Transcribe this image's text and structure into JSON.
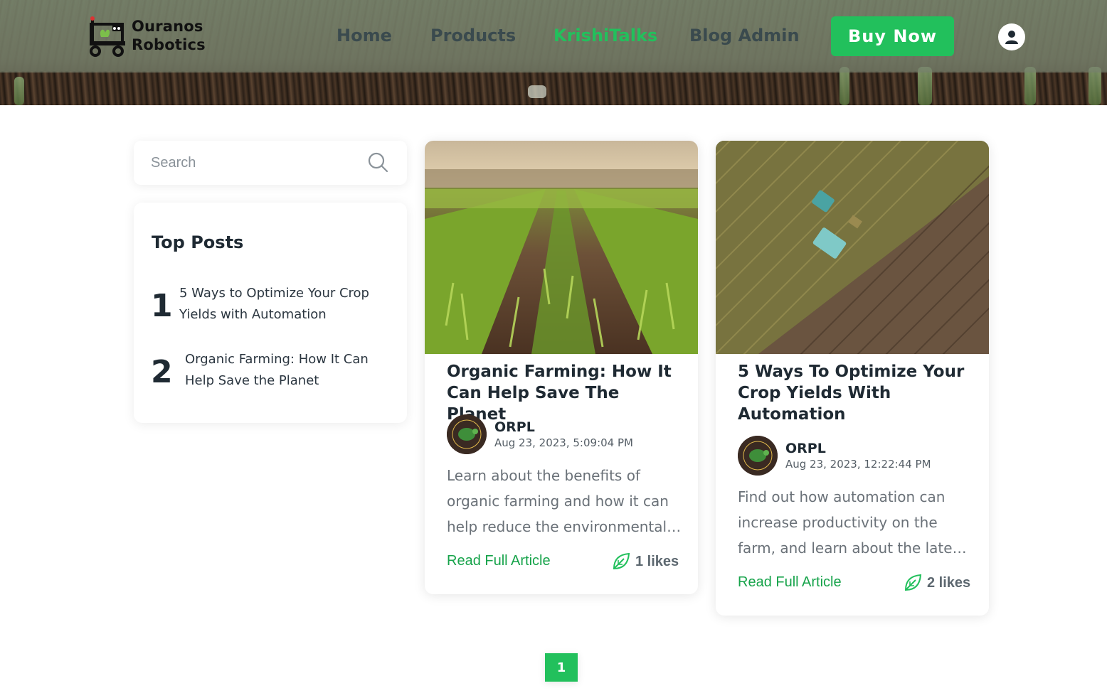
{
  "brand": {
    "name_line1": "Ouranos",
    "name_line2": "Robotics",
    "accent": "#22c05c"
  },
  "nav": {
    "items": [
      {
        "label": "Home",
        "active": false
      },
      {
        "label": "Products",
        "active": false
      },
      {
        "label": "KrishiTalks",
        "active": true
      },
      {
        "label": "Blog Admin",
        "active": false
      }
    ],
    "buy_label": "Buy Now",
    "user_icon": "user-icon"
  },
  "search": {
    "placeholder": "Search",
    "icon": "search-icon"
  },
  "top_posts": {
    "title": "Top Posts",
    "items": [
      {
        "rank": "1",
        "title": "5 Ways to Optimize Your Crop Yields with Automation"
      },
      {
        "rank": "2",
        "title": "Organic Farming: How It Can Help Save the Planet"
      }
    ]
  },
  "posts": [
    {
      "title": "Organic Farming: How It Can Help Save The Planet",
      "author": "ORPL",
      "date": "Aug 23, 2023, 5:09:04 PM",
      "excerpt": "Learn about the benefits of organic farming and how it can help reduce the environmental…",
      "read_label": "Read Full Article",
      "likes": "1 likes"
    },
    {
      "title": "5 Ways To Optimize Your Crop Yields With Automation",
      "author": "ORPL",
      "date": "Aug 23, 2023, 12:22:44 PM",
      "excerpt": "Find out how automation can increase productivity on the farm, and learn about the late…",
      "read_label": "Read Full Article",
      "likes": "2 likes"
    }
  ],
  "pagination": {
    "current": "1"
  }
}
